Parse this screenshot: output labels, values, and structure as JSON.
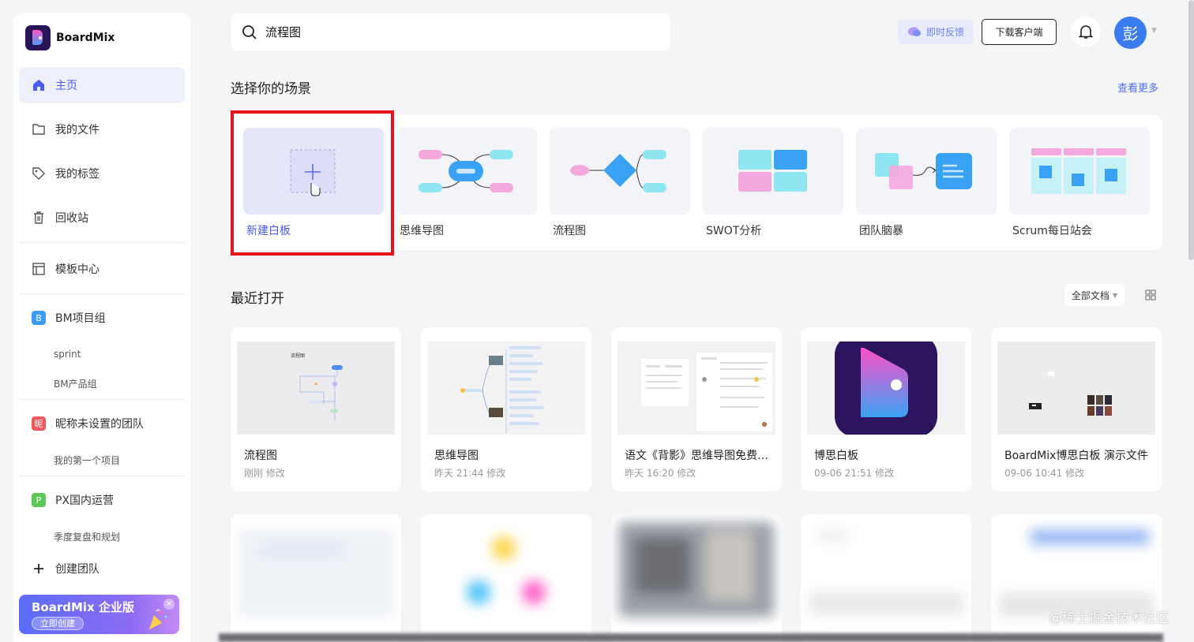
{
  "brand": {
    "name": "BoardMix"
  },
  "sidebar": {
    "nav": [
      {
        "label": "主页",
        "icon": "home-icon",
        "active": true
      },
      {
        "label": "我的文件",
        "icon": "folder-icon"
      },
      {
        "label": "我的标签",
        "icon": "tag-icon"
      },
      {
        "label": "回收站",
        "icon": "trash-icon"
      },
      {
        "label": "模板中心",
        "icon": "template-icon"
      }
    ],
    "teams": [
      {
        "badge": "B",
        "color": "#3a9cf5",
        "name": "BM项目组",
        "projects": [
          "sprint",
          "BM产品组"
        ]
      },
      {
        "badge": "昵",
        "color": "#f0565a",
        "name": "昵称未设置的团队",
        "projects": [
          "我的第一个项目"
        ]
      },
      {
        "badge": "P",
        "color": "#5cc85a",
        "name": "PX国内运营",
        "projects": [
          "季度复盘和规划"
        ]
      }
    ],
    "create_team": "创建团队",
    "promo": {
      "title": "BoardMix 企业版",
      "button": "立即创建",
      "close": "×"
    }
  },
  "header": {
    "search_value": "流程图",
    "feedback": "即时反馈",
    "download": "下载客户端",
    "avatar_text": "彭"
  },
  "scenes": {
    "title": "选择你的场景",
    "see_more": "查看更多",
    "items": [
      {
        "label": "新建白板"
      },
      {
        "label": "思维导图"
      },
      {
        "label": "流程图"
      },
      {
        "label": "SWOT分析"
      },
      {
        "label": "团队脑暴"
      },
      {
        "label": "Scrum每日站会"
      }
    ]
  },
  "recent": {
    "title": "最近打开",
    "filter": "全部文档",
    "cards": [
      {
        "title": "流程图",
        "meta": "刚刚 修改",
        "thumb_title": "流程图"
      },
      {
        "title": "思维导图",
        "meta": "昨天 21:44 修改"
      },
      {
        "title": "语文《背影》思维导图免费…",
        "meta": "昨天 16:20 修改"
      },
      {
        "title": "博思白板",
        "meta": "09-06 21:51 修改"
      },
      {
        "title": "BoardMix博思白板 演示文件",
        "meta": "09-06 10:41 修改"
      }
    ]
  },
  "watermark": "@稀土掘金技术社区",
  "colors": {
    "accent": "#4b5cf0",
    "highlight": "#e4141c",
    "avatar": "#3a7bf0"
  }
}
